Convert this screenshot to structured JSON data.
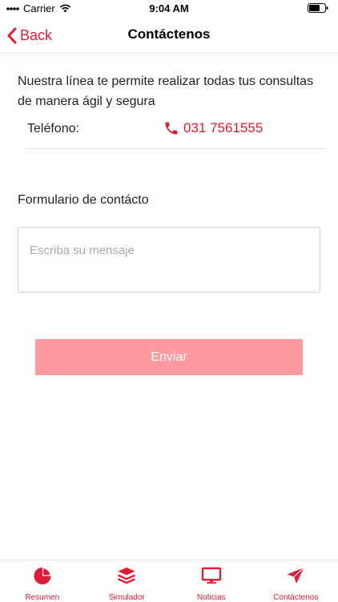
{
  "status_bar": {
    "carrier": "Carrier",
    "time": "9:04 AM"
  },
  "nav": {
    "back_label": "Back",
    "title": "Contáctenos"
  },
  "intro_text": "Nuestra línea te permite realizar todas tus consultas de manera ágil y segura",
  "phone": {
    "label": "Teléfono:",
    "number": "031 7561555"
  },
  "form": {
    "title": "Formulario de contácto",
    "message_placeholder": "Escriba su mensaje",
    "message_value": "",
    "send_label": "Enviar"
  },
  "tabs": [
    {
      "label": "Resumen",
      "icon": "pie-chart-icon"
    },
    {
      "label": "Simulador",
      "icon": "layers-icon"
    },
    {
      "label": "Noticias",
      "icon": "monitor-icon"
    },
    {
      "label": "Contáctenos",
      "icon": "paper-plane-icon"
    }
  ],
  "colors": {
    "accent": "#e01b35",
    "send_button": "#ff9aa0"
  }
}
